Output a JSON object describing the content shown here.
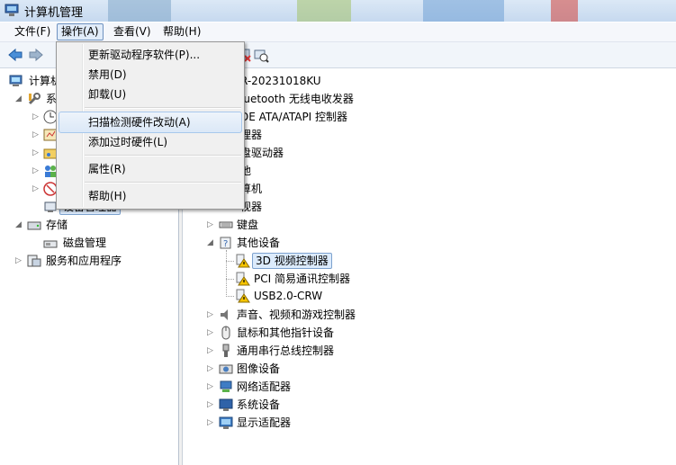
{
  "window": {
    "title": "计算机管理"
  },
  "menubar": {
    "file": "文件(F)",
    "action": "操作(A)",
    "view": "查看(V)",
    "help": "帮助(H)"
  },
  "dropdown": {
    "items": [
      "更新驱动程序软件(P)...",
      "禁用(D)",
      "卸载(U)",
      "扫描检测硬件改动(A)",
      "添加过时硬件(L)",
      "属性(R)",
      "帮助(H)"
    ]
  },
  "left_tree": {
    "root": "计算机",
    "system_tools": "系",
    "device_manager": "设备管理器",
    "storage": "存储",
    "disk_mgmt": "磁盘管理",
    "services": "服务和应用程序"
  },
  "right_tree": {
    "computer": "R-20231018KU",
    "items": [
      "luetooth 无线电收发器",
      "DE ATA/ATAPI 控制器",
      "理器",
      "盘驱动器",
      "池",
      "算机",
      "视器",
      "键盘",
      "其他设备"
    ],
    "other_devices": [
      "3D 视频控制器",
      "PCI 简易通讯控制器",
      "USB2.0-CRW"
    ],
    "items2": [
      "声音、视频和游戏控制器",
      "鼠标和其他指针设备",
      "通用串行总线控制器",
      "图像设备",
      "网络适配器",
      "系统设备",
      "显示适配器"
    ]
  }
}
